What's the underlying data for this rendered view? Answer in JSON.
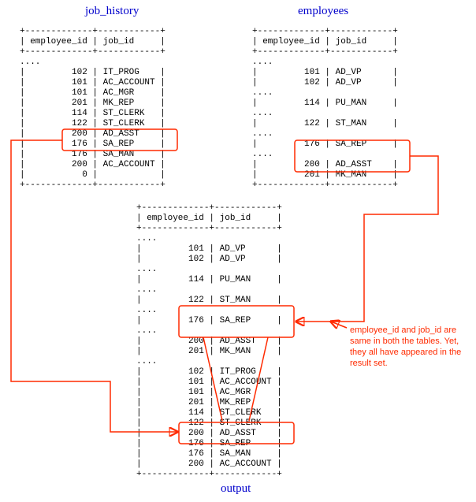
{
  "titles": {
    "job_history": "job_history",
    "employees": "employees",
    "output": "output"
  },
  "columns": {
    "employee_id": "employee_id",
    "job_id": "job_id"
  },
  "dots": "....",
  "job_history_rows": [
    {
      "employee_id": "102",
      "job_id": "IT_PROG"
    },
    {
      "employee_id": "101",
      "job_id": "AC_ACCOUNT"
    },
    {
      "employee_id": "101",
      "job_id": "AC_MGR"
    },
    {
      "employee_id": "201",
      "job_id": "MK_REP"
    },
    {
      "employee_id": "114",
      "job_id": "ST_CLERK"
    },
    {
      "employee_id": "122",
      "job_id": "ST_CLERK"
    },
    {
      "employee_id": "200",
      "job_id": "AD_ASST"
    },
    {
      "employee_id": "176",
      "job_id": "SA_REP"
    },
    {
      "employee_id": "176",
      "job_id": "SA_MAN"
    },
    {
      "employee_id": "200",
      "job_id": "AC_ACCOUNT"
    },
    {
      "employee_id": "0",
      "job_id": ""
    }
  ],
  "employees_rows": [
    {
      "employee_id": "101",
      "job_id": "AD_VP"
    },
    {
      "employee_id": "102",
      "job_id": "AD_VP"
    },
    {
      "employee_id": "",
      "job_id": ""
    },
    {
      "employee_id": "114",
      "job_id": "PU_MAN"
    },
    {
      "employee_id": "",
      "job_id": ""
    },
    {
      "employee_id": "122",
      "job_id": "ST_MAN"
    },
    {
      "employee_id": "",
      "job_id": ""
    },
    {
      "employee_id": "176",
      "job_id": "SA_REP"
    },
    {
      "employee_id": "",
      "job_id": ""
    },
    {
      "employee_id": "200",
      "job_id": "AD_ASST"
    },
    {
      "employee_id": "201",
      "job_id": "MK_MAN"
    }
  ],
  "output_top_rows": [
    {
      "employee_id": "101",
      "job_id": "AD_VP"
    },
    {
      "employee_id": "102",
      "job_id": "AD_VP"
    },
    {
      "employee_id": "",
      "job_id": ""
    },
    {
      "employee_id": "114",
      "job_id": "PU_MAN"
    },
    {
      "employee_id": "",
      "job_id": ""
    },
    {
      "employee_id": "122",
      "job_id": "ST_MAN"
    },
    {
      "employee_id": "",
      "job_id": ""
    },
    {
      "employee_id": "176",
      "job_id": "SA_REP"
    },
    {
      "employee_id": "",
      "job_id": ""
    },
    {
      "employee_id": "200",
      "job_id": "AD_ASST"
    },
    {
      "employee_id": "201",
      "job_id": "MK_MAN"
    }
  ],
  "output_bottom_rows": [
    {
      "employee_id": "102",
      "job_id": "IT_PROG"
    },
    {
      "employee_id": "101",
      "job_id": "AC_ACCOUNT"
    },
    {
      "employee_id": "101",
      "job_id": "AC_MGR"
    },
    {
      "employee_id": "201",
      "job_id": "MK_REP"
    },
    {
      "employee_id": "114",
      "job_id": "ST_CLERK"
    },
    {
      "employee_id": "122",
      "job_id": "ST_CLERK"
    },
    {
      "employee_id": "200",
      "job_id": "AD_ASST"
    },
    {
      "employee_id": "176",
      "job_id": "SA_REP"
    },
    {
      "employee_id": "176",
      "job_id": "SA_MAN"
    },
    {
      "employee_id": "200",
      "job_id": "AC_ACCOUNT"
    }
  ],
  "annotation": "employee_id and job_id are same in both the tables. Yet, they all have appeared in the result set."
}
